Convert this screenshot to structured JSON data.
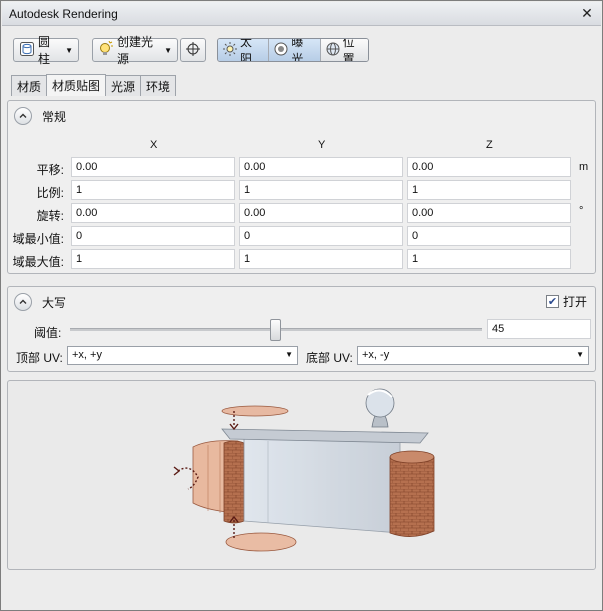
{
  "window": {
    "title": "Autodesk Rendering"
  },
  "toolbar": {
    "cylinder_label": "圆柱",
    "create_light_label": "创建光源",
    "sun_label": "太阳",
    "exposure_label": "曝光",
    "location_label": "位置"
  },
  "tabs": [
    {
      "label": "材质",
      "active": false
    },
    {
      "label": "材质贴图",
      "active": true
    },
    {
      "label": "光源",
      "active": false
    },
    {
      "label": "环境",
      "active": false
    }
  ],
  "general": {
    "title": "常规",
    "col_x": "X",
    "col_y": "Y",
    "col_z": "Z",
    "rows": [
      {
        "label": "平移:",
        "x": "0.00",
        "y": "0.00",
        "z": "0.00",
        "unit": "m"
      },
      {
        "label": "比例:",
        "x": "1",
        "y": "1",
        "z": "1",
        "unit": ""
      },
      {
        "label": "旋转:",
        "x": "0.00",
        "y": "0.00",
        "z": "0.00",
        "unit": "°"
      },
      {
        "label": "域最小值:",
        "x": "0",
        "y": "0",
        "z": "0",
        "unit": ""
      },
      {
        "label": "域最大值:",
        "x": "1",
        "y": "1",
        "z": "1",
        "unit": ""
      }
    ]
  },
  "capping": {
    "title": "大写",
    "open_label": "打开",
    "open_checked": true,
    "threshold_label": "阈值:",
    "threshold_value": "45",
    "threshold_fraction": 0.5,
    "top_uv_label": "顶部 UV:",
    "top_uv_value": "+x, +y",
    "bottom_uv_label": "底部 UV:",
    "bottom_uv_value": "+x, -y"
  },
  "colors": {
    "accent": "#b7cde6",
    "brick": "#b5704f",
    "arrow": "#5a1a14"
  }
}
